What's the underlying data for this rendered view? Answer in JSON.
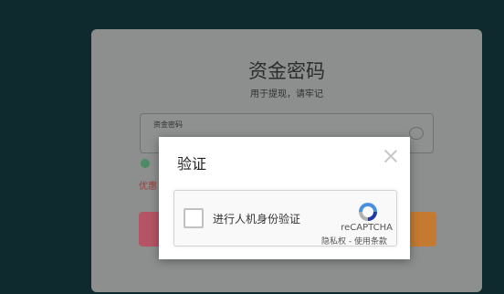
{
  "background_page": {
    "title": "资金密码",
    "subtitle": "用于提现，请牢记",
    "field_label": "资金密码",
    "red_text": "优惠"
  },
  "dialog": {
    "title": "验证",
    "close_icon": "close-icon"
  },
  "recaptcha": {
    "checkbox_label": "进行人机身份验证",
    "brand": "reCAPTCHA",
    "privacy_link": "隐私权",
    "separator": " - ",
    "terms_link": "使用条款",
    "logo_colors": {
      "blue": "#4a90e2",
      "dark_blue": "#1c3aa9",
      "gray": "#b0b0b0"
    }
  }
}
